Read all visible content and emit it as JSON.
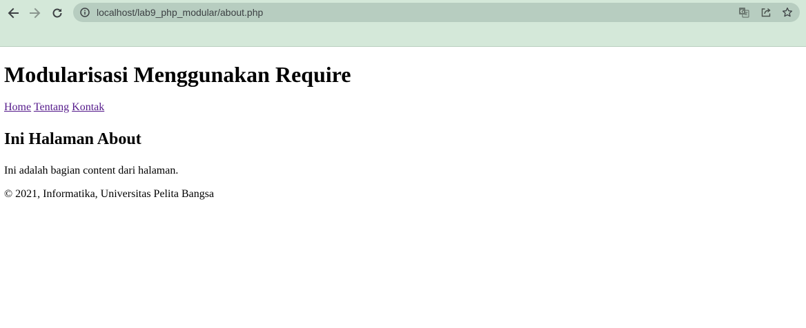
{
  "browser": {
    "url": "localhost/lab9_php_modular/about.php",
    "chrome_color": "#d4e8d9",
    "omnibox_color": "#b7cdc0",
    "icons": [
      "back-arrow-icon",
      "forward-arrow-icon",
      "reload-icon",
      "info-icon",
      "translate-icon",
      "share-icon",
      "bookmark-star-icon"
    ]
  },
  "page": {
    "title": "Modularisasi Menggunakan Require",
    "nav": [
      {
        "label": "Home"
      },
      {
        "label": "Tentang"
      },
      {
        "label": "Kontak"
      }
    ],
    "heading": "Ini Halaman About",
    "content": "Ini adalah bagian content dari halaman.",
    "footer": "© 2021, Informatika, Universitas Pelita Bangsa",
    "link_color": "#551a8b"
  }
}
